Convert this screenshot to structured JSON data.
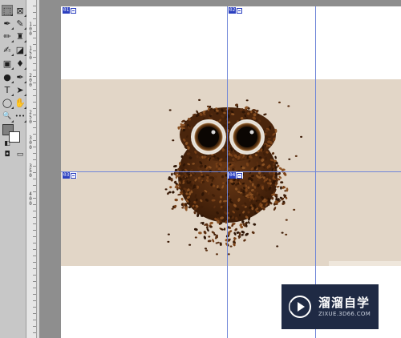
{
  "tools": [
    {
      "name": "rectangular-marquee-tool",
      "icon": "marquee-icon",
      "glyph": "⬚",
      "active": true
    },
    {
      "name": "slice-tool",
      "icon": "slice-icon",
      "glyph": "⊠"
    },
    {
      "name": "eyedropper-tool",
      "icon": "eyedropper-icon",
      "glyph": "✒"
    },
    {
      "name": "healing-brush-tool",
      "icon": "bandage-icon",
      "glyph": "✎"
    },
    {
      "name": "brush-tool",
      "icon": "brush-icon",
      "glyph": "✏"
    },
    {
      "name": "clone-stamp-tool",
      "icon": "stamp-icon",
      "glyph": "♜"
    },
    {
      "name": "history-brush-tool",
      "icon": "history-brush-icon",
      "glyph": "✍"
    },
    {
      "name": "eraser-tool",
      "icon": "eraser-icon",
      "glyph": "◪"
    },
    {
      "name": "gradient-tool",
      "icon": "gradient-icon",
      "glyph": "▣"
    },
    {
      "name": "blur-tool",
      "icon": "drop-icon",
      "glyph": "♦"
    },
    {
      "name": "dodge-tool",
      "icon": "dodge-icon",
      "glyph": "●"
    },
    {
      "name": "pen-tool",
      "icon": "pen-icon",
      "glyph": "✒"
    },
    {
      "name": "type-tool",
      "icon": "type-icon",
      "glyph": "T"
    },
    {
      "name": "path-selection-tool",
      "icon": "arrow-icon",
      "glyph": "➤"
    },
    {
      "name": "ellipse-tool",
      "icon": "ellipse-icon",
      "glyph": "◯"
    },
    {
      "name": "hand-tool",
      "icon": "hand-icon",
      "glyph": "✋"
    },
    {
      "name": "zoom-tool",
      "icon": "magnifier-icon",
      "glyph": "🔍"
    },
    {
      "name": "more-tools",
      "icon": "ellipsis-icon",
      "glyph": "•••"
    }
  ],
  "colors": {
    "foreground": "#7f7f7f",
    "background": "#ffffff",
    "guide": "#6f86d8",
    "slice_badge": "#2b3fbf",
    "photo_bg": "#e2d6c7",
    "watermark_bg": "#1f2a44"
  },
  "ruler_labels": [
    "1",
    "0",
    "0",
    "1",
    "5",
    "0",
    "2",
    "0",
    "0",
    "2",
    "5",
    "0",
    "3",
    "0",
    "0",
    "3",
    "5",
    "0",
    "4",
    "0",
    "0"
  ],
  "slices": [
    "01",
    "02",
    "03",
    "04"
  ],
  "watermark": {
    "title": "溜溜自学",
    "url": "ZIXUE.3D66.COM"
  }
}
